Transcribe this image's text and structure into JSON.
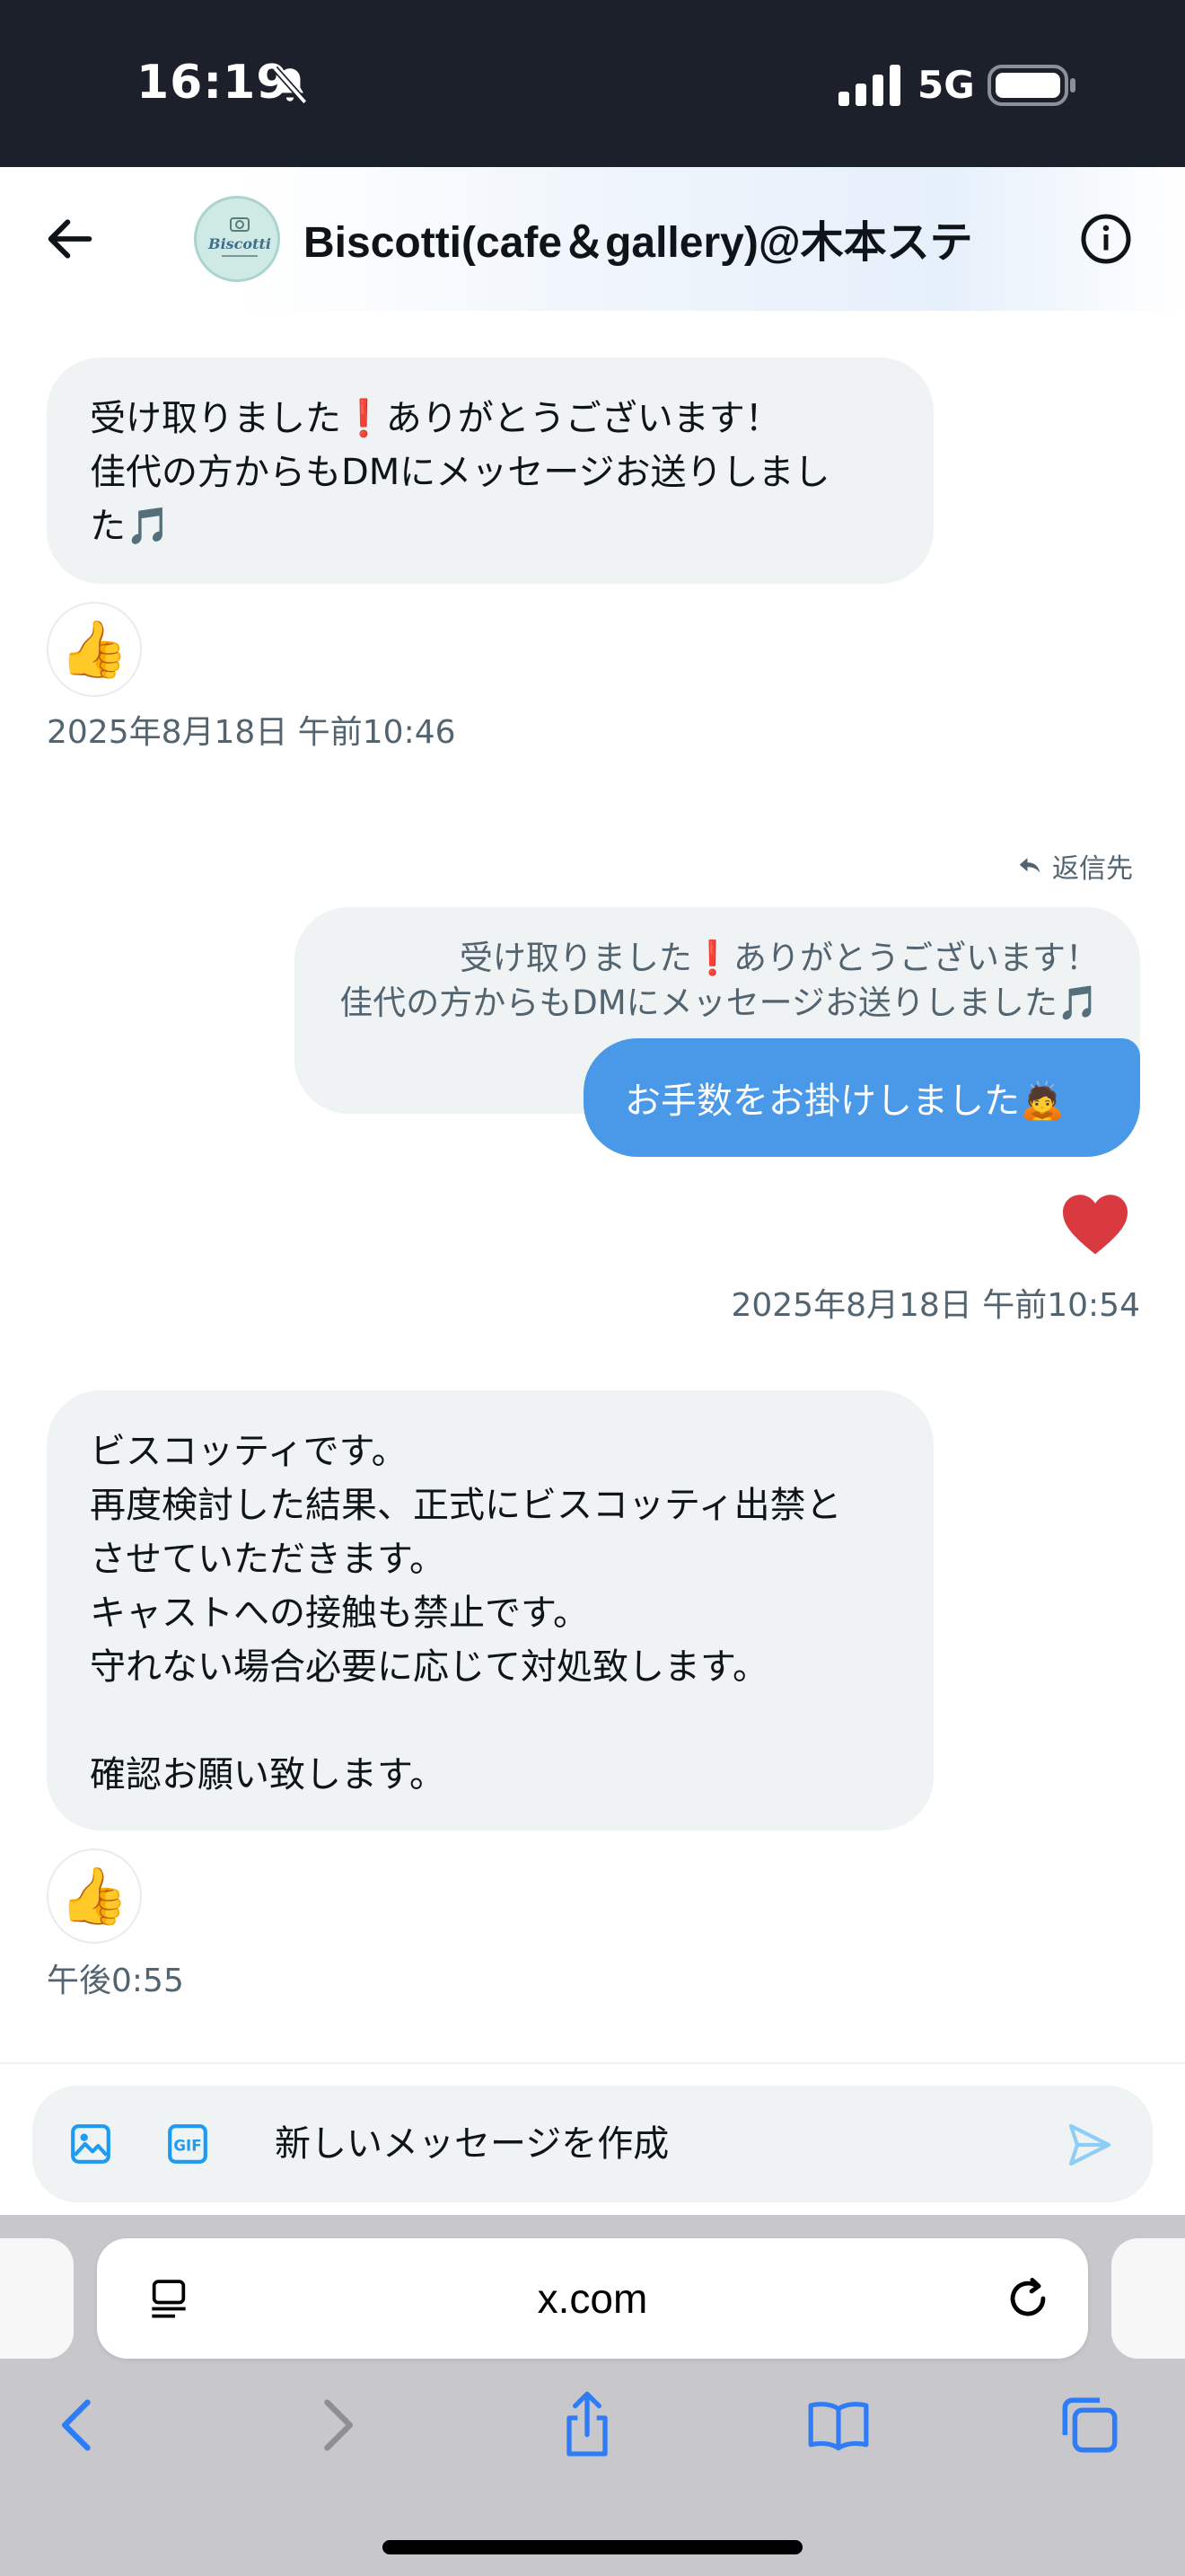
{
  "status_bar": {
    "time": "16:19",
    "network": "5G"
  },
  "header": {
    "title": "Biscotti(cafe＆gallery)@木本ステ",
    "avatar_text": "Biscotti"
  },
  "messages": {
    "m1": {
      "text": "受け取りました❗️ありがとうございます！\n佳代の方からもDMにメッセージお送りしまし\nた🎵",
      "reaction": "👍",
      "timestamp": "2025年8月18日 午前10:46"
    },
    "m2": {
      "reply_label": "返信先",
      "quoted_text": "受け取りました❗️ありがとうございます！\n佳代の方からもDMにメッセージお送りしました🎵",
      "text": "お手数をお掛けしました🙇",
      "reaction": "❤️",
      "timestamp": "2025年8月18日 午前10:54"
    },
    "m3": {
      "text": "ビスコッティです。\n再度検討した結果、正式にビスコッティ出禁と\nさせていただきます。\nキャストへの接触も禁止です。\n守れない場合必要に応じて対処致します。\n\n確認お願い致します。",
      "reaction": "👍",
      "timestamp": "午後0:55"
    }
  },
  "composer": {
    "placeholder": "新しいメッセージを作成"
  },
  "browser": {
    "url": "x.com"
  },
  "colors": {
    "accent": "#1d9bf0",
    "bubble_out": "#4a98e8",
    "bubble_in": "#eff3f4"
  }
}
